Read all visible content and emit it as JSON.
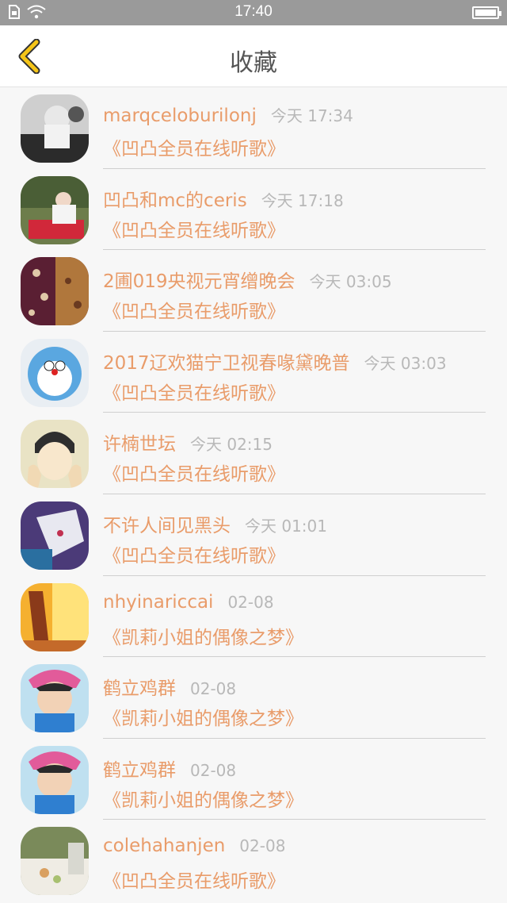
{
  "status_bar": {
    "time": "17:40"
  },
  "header": {
    "title": "收藏"
  },
  "colors": {
    "accent": "#e99c6a",
    "back_arrow": "#f5c518",
    "time_text": "#b8b8b8"
  },
  "items": [
    {
      "username": "marqceloburilonj",
      "time": "今天 17:34",
      "song": "《凹凸全员在线听歌》"
    },
    {
      "username": "凹凸和mc的ceris",
      "time": "今天 17:18",
      "song": "《凹凸全员在线听歌》"
    },
    {
      "username": "2圃019央视元宵缯晚会",
      "time": "今天 03:05",
      "song": "《凹凸全员在线听歌》"
    },
    {
      "username": "2017辽欢猫宁卫视春喙黛晚普",
      "time": "今天 03:03",
      "song": "《凹凸全员在线听歌》"
    },
    {
      "username": "许楠世坛",
      "time": "今天 02:15",
      "song": "《凹凸全员在线听歌》"
    },
    {
      "username": "不许人间见黑头",
      "time": "今天 01:01",
      "song": "《凹凸全员在线听歌》"
    },
    {
      "username": "nhyinariccai",
      "time": "02-08",
      "song": "《凯莉小姐的偶像之梦》"
    },
    {
      "username": "鹤立鸡群",
      "time": "02-08",
      "song": "《凯莉小姐的偶像之梦》"
    },
    {
      "username": "鹤立鸡群",
      "time": "02-08",
      "song": "《凯莉小姐的偶像之梦》"
    },
    {
      "username": "colehahanjen",
      "time": "02-08",
      "song": "《凹凸全员在线听歌》"
    }
  ]
}
